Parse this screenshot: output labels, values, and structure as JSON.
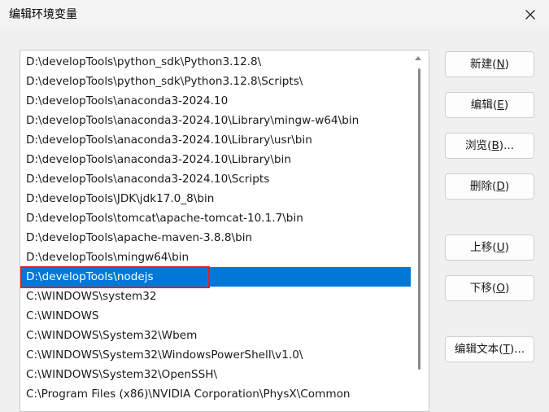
{
  "window": {
    "title": "编辑环境变量"
  },
  "icons": {
    "close": "close-icon",
    "scroll_up": "chevron-up-icon"
  },
  "colors": {
    "selection": "#0078d7",
    "highlight_box": "#e0211c"
  },
  "paths": {
    "selected_index": 11,
    "items": [
      "D:\\developTools\\python_sdk\\Python3.12.8\\",
      "D:\\developTools\\python_sdk\\Python3.12.8\\Scripts\\",
      "D:\\developTools\\anaconda3-2024.10",
      "D:\\developTools\\anaconda3-2024.10\\Library\\mingw-w64\\bin",
      "D:\\developTools\\anaconda3-2024.10\\Library\\usr\\bin",
      "D:\\developTools\\anaconda3-2024.10\\Library\\bin",
      "D:\\developTools\\anaconda3-2024.10\\Scripts",
      "D:\\developTools\\JDK\\jdk17.0_8\\bin",
      "D:\\developTools\\tomcat\\apache-tomcat-10.1.7\\bin",
      "D:\\developTools\\apache-maven-3.8.8\\bin",
      "D:\\developTools\\mingw64\\bin",
      "D:\\developTools\\nodejs",
      "C:\\WINDOWS\\system32",
      "C:\\WINDOWS",
      "C:\\WINDOWS\\System32\\Wbem",
      "C:\\WINDOWS\\System32\\WindowsPowerShell\\v1.0\\",
      "C:\\WINDOWS\\System32\\OpenSSH\\",
      "C:\\Program Files (x86)\\NVIDIA Corporation\\PhysX\\Common"
    ]
  },
  "buttons": {
    "new": {
      "label": "新建(",
      "mnemonic": "N",
      "suffix": ")"
    },
    "edit": {
      "label": "编辑(",
      "mnemonic": "E",
      "suffix": ")"
    },
    "browse": {
      "label": "浏览(",
      "mnemonic": "B",
      "suffix": ")..."
    },
    "delete": {
      "label": "删除(",
      "mnemonic": "D",
      "suffix": ")"
    },
    "move_up": {
      "label": "上移(",
      "mnemonic": "U",
      "suffix": ")"
    },
    "move_down": {
      "label": "下移(",
      "mnemonic": "O",
      "suffix": ")"
    },
    "edit_text": {
      "label": "编辑文本(",
      "mnemonic": "T",
      "suffix": ")..."
    }
  }
}
